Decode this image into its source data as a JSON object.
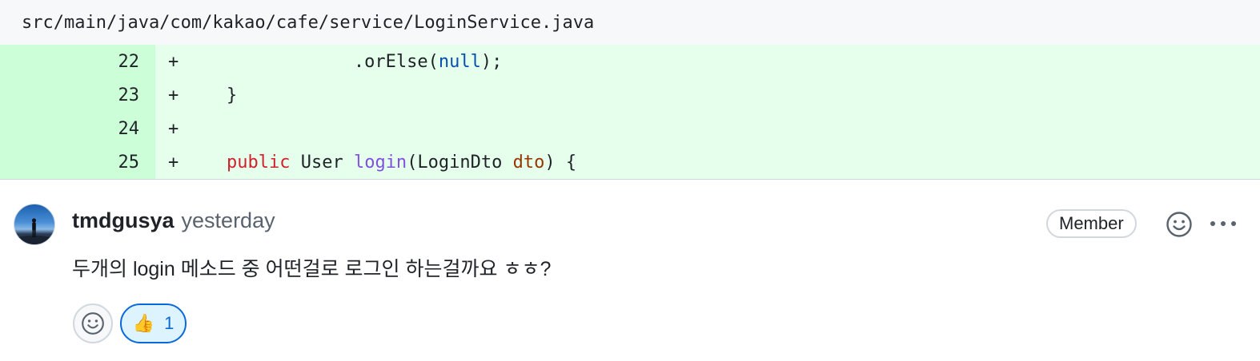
{
  "file": {
    "path": "src/main/java/com/kakao/cafe/service/LoginService.java"
  },
  "diff": {
    "lines": [
      {
        "number": "22",
        "marker": "+"
      },
      {
        "number": "23",
        "marker": "+"
      },
      {
        "number": "24",
        "marker": "+"
      },
      {
        "number": "25",
        "marker": "+"
      }
    ],
    "code": {
      "l22_indent": "                ",
      "l22_method": ".orElse(",
      "l22_null": "null",
      "l22_end": ");",
      "l23": "    }",
      "l24": "",
      "l25_indent": "    ",
      "l25_public": "public",
      "l25_type": " User ",
      "l25_name": "login",
      "l25_open": "(LoginDto ",
      "l25_param": "dto",
      "l25_close": ") {"
    }
  },
  "comment": {
    "author": "tmdgusya",
    "time": "yesterday",
    "badge": "Member",
    "body": "두개의 login 메소드 중 어떤걸로 로그인 하는걸까요 ㅎㅎ?",
    "reactions": [
      {
        "emoji": "👍",
        "icon": "thumbs-up-icon",
        "count": "1"
      }
    ]
  },
  "colors": {
    "line_number_added": "#ccffd8",
    "code_added": "#e6ffec",
    "keyword": "#cf222e",
    "function": "#8250df",
    "literal": "#0550ae",
    "parameter": "#953800",
    "reaction_accent": "#0969da"
  }
}
